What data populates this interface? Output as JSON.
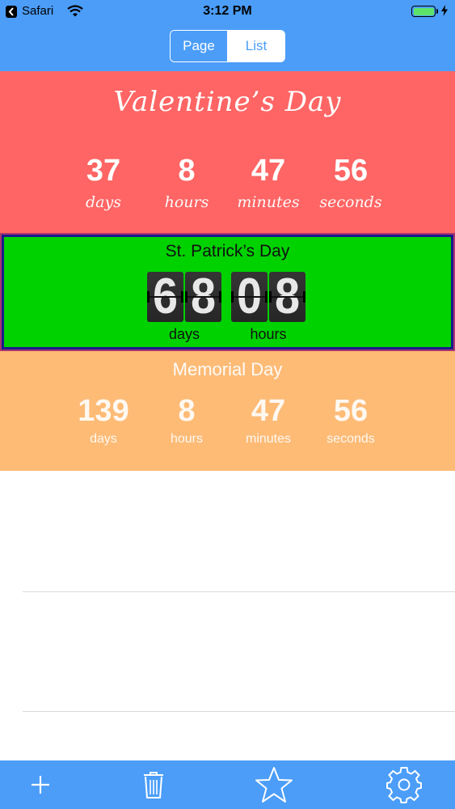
{
  "status_bar": {
    "back_app": "Safari",
    "time": "3:12 PM"
  },
  "segmented": {
    "page_label": "Page",
    "list_label": "List"
  },
  "events": {
    "valentine": {
      "title": "Valentine’s Day",
      "background": "#fe6564",
      "days": "37",
      "hours": "8",
      "minutes": "47",
      "seconds": "56",
      "days_label": "days",
      "hours_label": "hours",
      "minutes_label": "minutes",
      "seconds_label": "seconds"
    },
    "patrick": {
      "title": "St. Patrick’s Day",
      "background": "#00d200",
      "day_digits": [
        "6",
        "8"
      ],
      "hour_digits": [
        "0",
        "8"
      ],
      "days_label": "days",
      "hours_label": "hours"
    },
    "memorial": {
      "title": "Memorial Day",
      "background": "#fdbb76",
      "days": "139",
      "hours": "8",
      "minutes": "47",
      "seconds": "56",
      "days_label": "days",
      "hours_label": "hours",
      "minutes_label": "minutes",
      "seconds_label": "seconds"
    }
  },
  "toolbar": {
    "icons": [
      "plus-icon",
      "trash-icon",
      "star-icon",
      "gear-icon"
    ],
    "accent": "#4b9df8"
  }
}
